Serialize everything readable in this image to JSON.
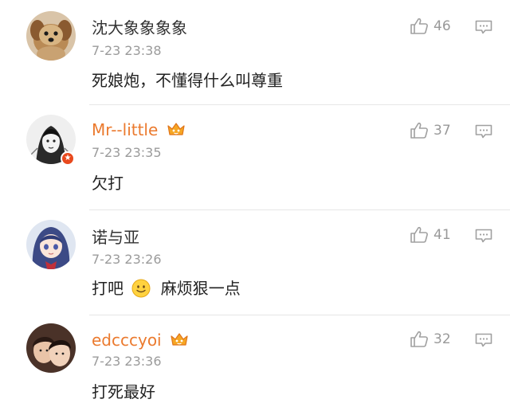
{
  "comments": [
    {
      "username": "沈大象象象象",
      "time": "7-23 23:38",
      "text": "死娘炮，不懂得什么叫尊重",
      "likes": "46",
      "vip": false,
      "avatar": "dog-avatar"
    },
    {
      "username": "Mr--little",
      "time": "7-23 23:35",
      "text": "欠打",
      "likes": "37",
      "vip": true,
      "avatar": "sketch-avatar"
    },
    {
      "username": "诺与亚",
      "time": "7-23 23:26",
      "text_before": "打吧",
      "text_after": "麻烦狠一点",
      "emoji": "smile-emoji",
      "likes": "41",
      "vip": false,
      "avatar": "anime-girl-avatar"
    },
    {
      "username": "edcccyoi",
      "time": "7-23 23:36",
      "text": "打死最好",
      "likes": "32",
      "vip": true,
      "avatar": "couple-photo-avatar"
    }
  ],
  "colors": {
    "username": "#333333",
    "vip_username": "#eb7a2e",
    "meta": "#9b9b9b",
    "icon": "#a0a0a0"
  }
}
